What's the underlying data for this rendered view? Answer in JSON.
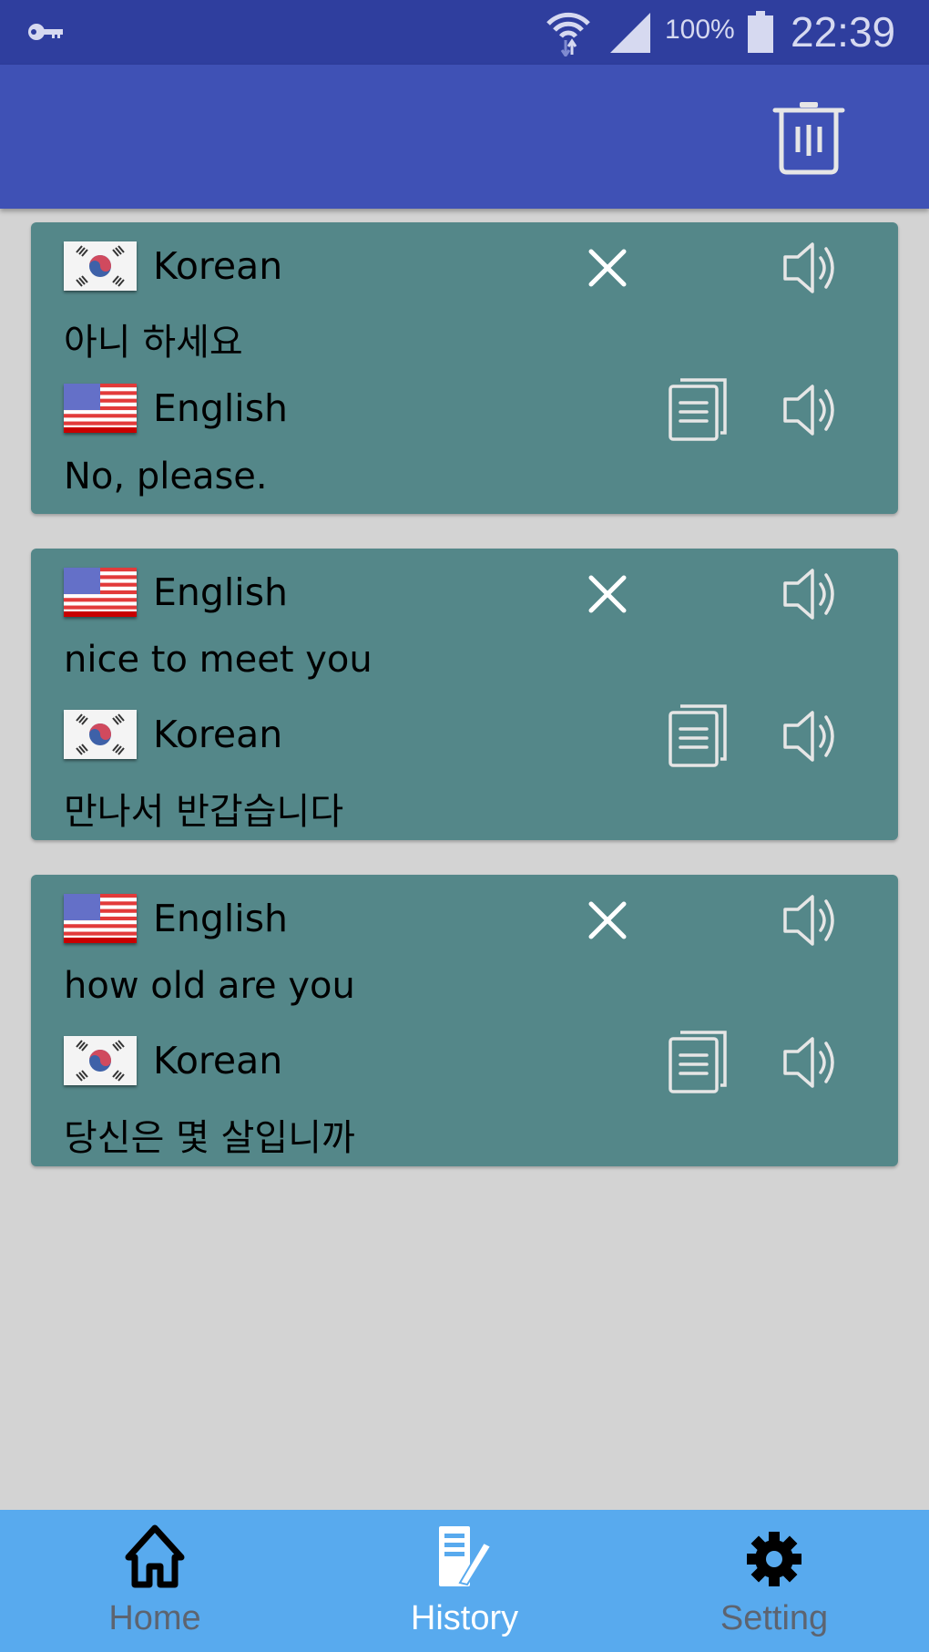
{
  "status_bar": {
    "battery_percent": "100%",
    "time": "22:39",
    "icons": [
      "vpn-key-icon",
      "wifi-icon",
      "signal-icon",
      "battery-icon"
    ]
  },
  "app_bar": {
    "actions": [
      {
        "icon": "trash-icon",
        "label": "Delete all history"
      }
    ]
  },
  "history": [
    {
      "source_lang": "Korean",
      "source_flag": "korea-flag",
      "source_text": "아니 하세요",
      "target_lang": "English",
      "target_flag": "usa-flag",
      "target_text": "No, please."
    },
    {
      "source_lang": "English",
      "source_flag": "usa-flag",
      "source_text": "nice to meet you",
      "target_lang": "Korean",
      "target_flag": "korea-flag",
      "target_text": "만나서 반갑습니다"
    },
    {
      "source_lang": "English",
      "source_flag": "usa-flag",
      "source_text": "how old are you",
      "target_lang": "Korean",
      "target_flag": "korea-flag",
      "target_text": "당신은 몇 살입니까"
    }
  ],
  "bottom_nav": {
    "items": [
      {
        "label": "Home",
        "icon": "home-icon",
        "active": false
      },
      {
        "label": "History",
        "icon": "history-icon",
        "active": true
      },
      {
        "label": "Setting",
        "icon": "gear-icon",
        "active": false
      }
    ],
    "active_color": "#ffffff",
    "inactive_color": "#5d6470"
  },
  "colors": {
    "status_bar": "#2f3e9e",
    "app_bar": "#3f51b5",
    "card": "#548789",
    "background": "#d3d3d3",
    "bottom_nav": "#58aaee"
  }
}
